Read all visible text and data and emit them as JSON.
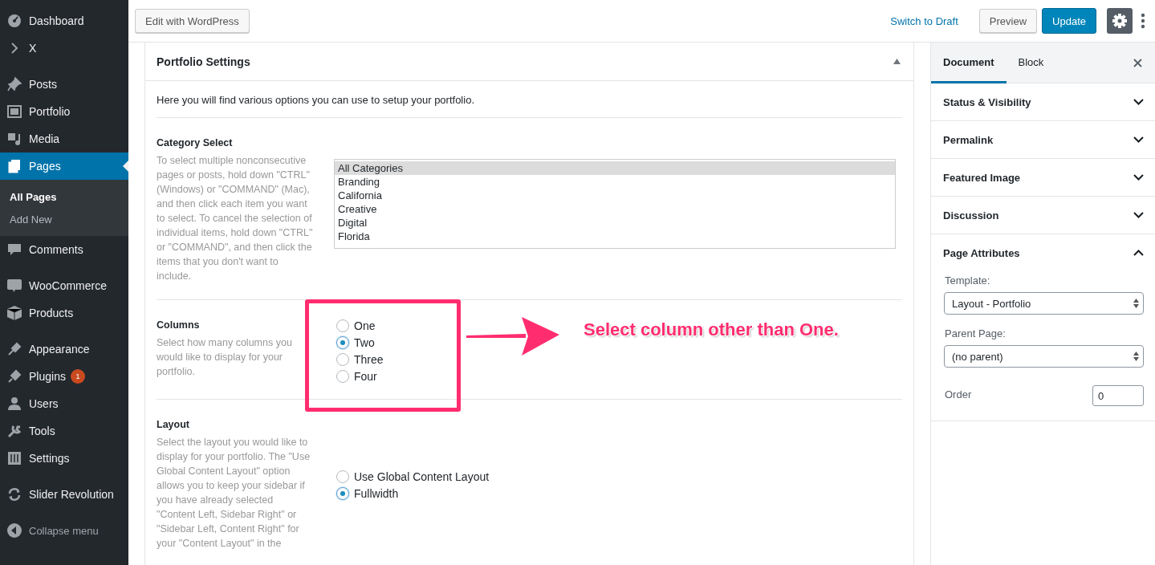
{
  "sidebar": {
    "groups": [
      [
        {
          "label": "Dashboard",
          "selected": false
        },
        {
          "label": "X",
          "selected": false
        }
      ],
      [
        {
          "label": "Posts",
          "selected": false
        },
        {
          "label": "Portfolio",
          "selected": false
        },
        {
          "label": "Media",
          "selected": false
        },
        {
          "label": "Pages",
          "selected": true,
          "children": [
            {
              "label": "All Pages",
              "selected": true
            },
            {
              "label": "Add New",
              "selected": false
            }
          ]
        },
        {
          "label": "Comments",
          "selected": false
        }
      ],
      [
        {
          "label": "WooCommerce",
          "selected": false
        },
        {
          "label": "Products",
          "selected": false
        }
      ],
      [
        {
          "label": "Appearance",
          "selected": false
        },
        {
          "label": "Plugins",
          "selected": false,
          "badge": "1"
        },
        {
          "label": "Users",
          "selected": false
        },
        {
          "label": "Tools",
          "selected": false
        },
        {
          "label": "Settings",
          "selected": false
        }
      ],
      [
        {
          "label": "Slider Revolution",
          "selected": false
        }
      ]
    ],
    "collapse_button": "Collapse menu"
  },
  "top_bar": {
    "edit_button": "Edit with WordPress",
    "draft_link": "Switch to Draft",
    "preview_button": "Preview",
    "update_button": "Update",
    "settings_button": {
      "pressed": true
    }
  },
  "metabox": {
    "title": "Portfolio Settings",
    "expanded": true,
    "intro": "Here you will find various options you can use to setup your portfolio.",
    "sections": [
      {
        "kind": "listbox",
        "label": "Category Select",
        "description": "To select multiple nonconsecutive pages or posts, hold down \"CTRL\" (Windows) or \"COMMAND\" (Mac), and then click each item you want to select. To cancel the selection of individual items, hold down \"CTRL\" or \"COMMAND\", and then click the items that you don't want to include.",
        "options": [
          {
            "label": "All Categories",
            "selected": true
          },
          {
            "label": "Branding",
            "selected": false
          },
          {
            "label": "California",
            "selected": false
          },
          {
            "label": "Creative",
            "selected": false
          },
          {
            "label": "Digital",
            "selected": false
          },
          {
            "label": "Florida",
            "selected": false
          }
        ]
      },
      {
        "kind": "radio",
        "label": "Columns",
        "description": "Select how many columns you would like to display for your portfolio.",
        "options": [
          {
            "label": "One",
            "selected": false
          },
          {
            "label": "Two",
            "selected": true
          },
          {
            "label": "Three",
            "selected": false
          },
          {
            "label": "Four",
            "selected": false
          }
        ]
      },
      {
        "kind": "radio",
        "label": "Layout",
        "description": "Select the layout you would like to display for your portfolio. The \"Use Global Content Layout\" option allows you to keep your sidebar if you have already selected \"Content Left, Sidebar Right\" or \"Sidebar Left, Content Right\" for your \"Content Layout\" in the",
        "options": [
          {
            "label": "Use Global Content Layout",
            "selected": false
          },
          {
            "label": "Fullwidth",
            "selected": true
          }
        ]
      }
    ]
  },
  "annotation": {
    "text": "Select column other than One."
  },
  "inspector": {
    "tabs": [
      {
        "label": "Document",
        "selected": true
      },
      {
        "label": "Block",
        "selected": false
      }
    ],
    "panels": [
      {
        "title": "Status & Visibility",
        "expanded": false
      },
      {
        "title": "Permalink",
        "expanded": false
      },
      {
        "title": "Featured Image",
        "expanded": false
      },
      {
        "title": "Discussion",
        "expanded": false
      },
      {
        "title": "Page Attributes",
        "expanded": true,
        "fields": [
          {
            "kind": "select",
            "label": "Template:",
            "value": "Layout - Portfolio"
          },
          {
            "kind": "select",
            "label": "Parent Page:",
            "value": "(no parent)"
          },
          {
            "kind": "number",
            "label": "Order",
            "value": "0"
          }
        ]
      }
    ]
  }
}
